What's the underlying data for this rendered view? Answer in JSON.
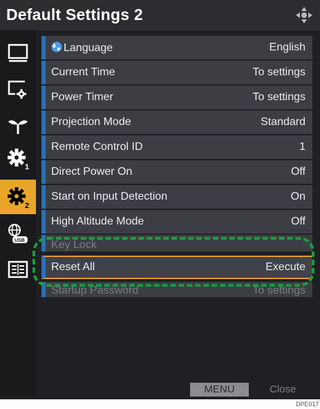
{
  "title": "Default Settings 2",
  "sidebar": {
    "items": [
      {
        "icon": "display-icon"
      },
      {
        "icon": "display-settings-icon"
      },
      {
        "icon": "eco-leaf-icon"
      },
      {
        "icon": "settings-1-icon"
      },
      {
        "icon": "settings-2-icon",
        "active": true
      },
      {
        "icon": "network-usb-icon"
      },
      {
        "icon": "info-panel-icon"
      }
    ]
  },
  "menu": {
    "items": [
      {
        "label": "Language",
        "value": "English"
      },
      {
        "label": "Current Time",
        "value": "To settings"
      },
      {
        "label": "Power Timer",
        "value": "To settings"
      },
      {
        "label": "Projection Mode",
        "value": "Standard"
      },
      {
        "label": "Remote Control ID",
        "value": "1"
      },
      {
        "label": "Direct Power On",
        "value": "Off"
      },
      {
        "label": "Start on Input Detection",
        "value": "On"
      },
      {
        "label": "High Altitude Mode",
        "value": "Off"
      },
      {
        "label": "Key Lock",
        "value": ""
      },
      {
        "label": "Reset All",
        "value": "Execute"
      },
      {
        "label": "Startup Password",
        "value": "To settings"
      }
    ]
  },
  "footer": {
    "menu_label": "MENU",
    "close_label": "Close"
  },
  "figure_code": "DPE017",
  "colors": {
    "accent_orange": "#e79a2a",
    "highlight_green": "#1e9a3d",
    "row_marker_blue": "#2b6fb6"
  }
}
